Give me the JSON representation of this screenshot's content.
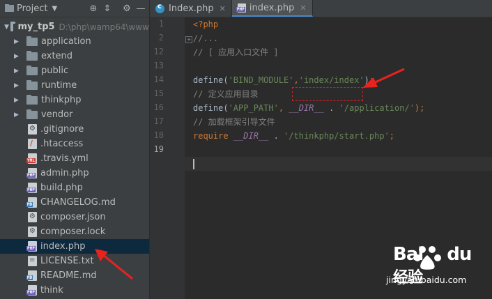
{
  "project_panel": {
    "title": "Project",
    "root": {
      "name": "my_tp5",
      "path": "D:\\php\\wamp64\\www"
    },
    "folders": [
      "application",
      "extend",
      "public",
      "runtime",
      "thinkphp",
      "vendor"
    ],
    "files": [
      {
        "name": ".gitignore",
        "icon": "gitignore-icon"
      },
      {
        "name": ".htaccess",
        "icon": "htaccess-icon"
      },
      {
        "name": ".travis.yml",
        "icon": "yml-file-icon",
        "tag": "YML"
      },
      {
        "name": "admin.php",
        "icon": "php-file-icon",
        "tag": "PHP"
      },
      {
        "name": "build.php",
        "icon": "php-file-icon",
        "tag": "PHP"
      },
      {
        "name": "CHANGELOG.md",
        "icon": "markdown-file-icon",
        "tag": "MD"
      },
      {
        "name": "composer.json",
        "icon": "json-file-icon"
      },
      {
        "name": "composer.lock",
        "icon": "lock-file-icon"
      },
      {
        "name": "index.php",
        "icon": "php-file-icon",
        "tag": "PHP",
        "selected": true
      },
      {
        "name": "LICENSE.txt",
        "icon": "text-file-icon"
      },
      {
        "name": "README.md",
        "icon": "markdown-file-icon",
        "tag": "MD"
      },
      {
        "name": "think",
        "icon": "php-file-icon",
        "tag": "PHP"
      }
    ]
  },
  "editor_tabs": [
    {
      "label": "Index.php",
      "active": false
    },
    {
      "label": "index.php",
      "active": true
    }
  ],
  "gutter": {
    "line_numbers": [
      "1",
      "2",
      "12",
      "13",
      "14",
      "15",
      "16",
      "17",
      "18",
      "19"
    ]
  },
  "code_lines": [
    [
      {
        "t": "<?php",
        "c": "kw"
      }
    ],
    [
      {
        "t": "//...",
        "c": "cm"
      }
    ],
    [
      {
        "t": "// [ 应用入口文件 ]",
        "c": "cm"
      }
    ],
    [],
    [
      {
        "t": "define(",
        "c": "fn"
      },
      {
        "t": "'BIND_MODULE'",
        "c": "str"
      },
      {
        "t": ",",
        "c": "kw"
      },
      {
        "t": "'index/index'",
        "c": "str"
      },
      {
        "t": ")",
        "c": "fn"
      },
      {
        "t": ";",
        "c": "kw"
      }
    ],
    [
      {
        "t": "// 定义应用目录",
        "c": "cm"
      }
    ],
    [
      {
        "t": "define(",
        "c": "fn"
      },
      {
        "t": "'APP_PATH'",
        "c": "str"
      },
      {
        "t": ", ",
        "c": "kw"
      },
      {
        "t": "__DIR__",
        "c": "const"
      },
      {
        "t": " . ",
        "c": "plain"
      },
      {
        "t": "'/application/'",
        "c": "str"
      },
      {
        "t": ");",
        "c": "kw"
      }
    ],
    [
      {
        "t": "// 加载框架引导文件",
        "c": "cm"
      }
    ],
    [
      {
        "t": "require ",
        "c": "kw"
      },
      {
        "t": "__DIR__",
        "c": "const"
      },
      {
        "t": " . ",
        "c": "plain"
      },
      {
        "t": "'/thinkphp/start.php'",
        "c": "str"
      },
      {
        "t": ";",
        "c": "kw"
      }
    ],
    []
  ],
  "watermark": {
    "brand_latin": "Bai",
    "brand_mid": "du",
    "brand_cn": "经验",
    "url": "jingyan.baidu.com"
  },
  "colors": {
    "selection": "#0d293e",
    "keyword": "#cc7832",
    "string": "#6a8759",
    "comment": "#808080",
    "annotation": "#e8231f"
  }
}
